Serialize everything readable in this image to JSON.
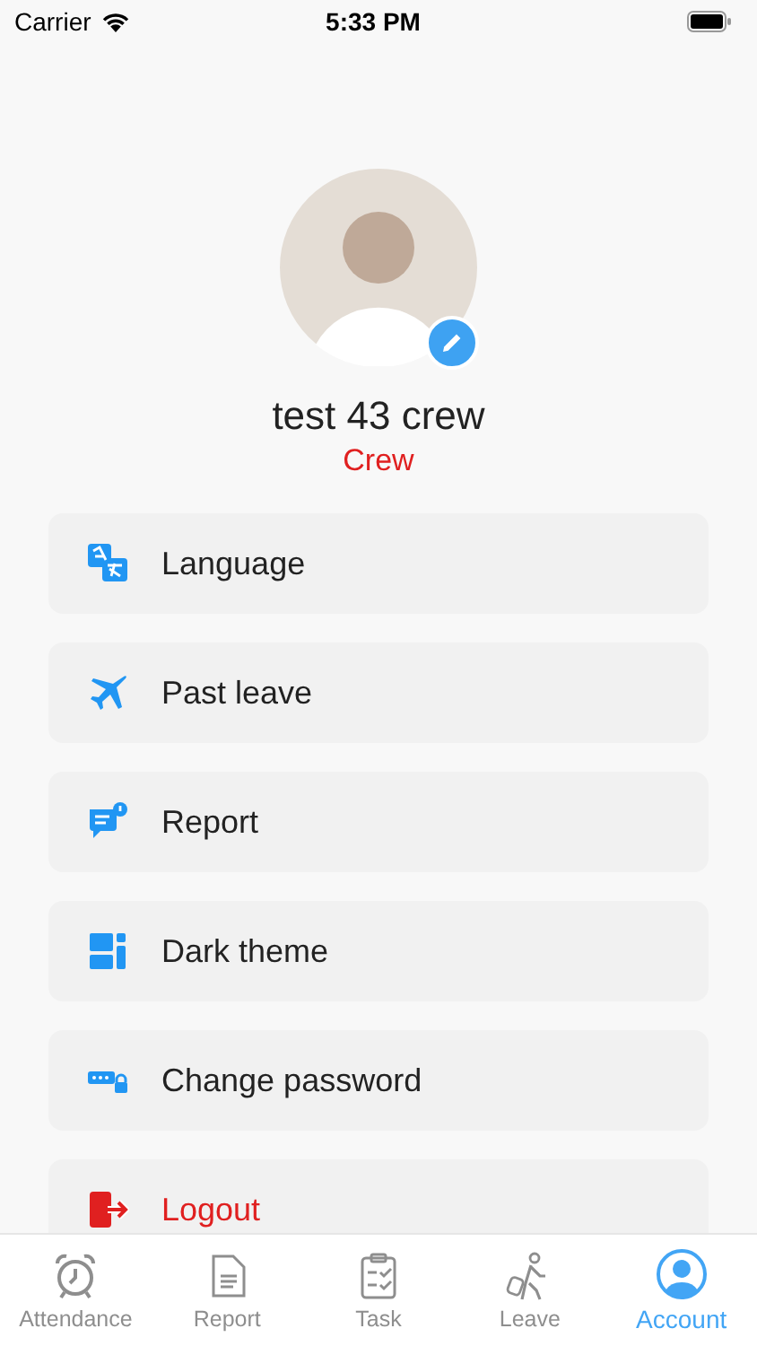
{
  "status_bar": {
    "carrier": "Carrier",
    "time": "5:33 PM"
  },
  "profile": {
    "name": "test 43 crew",
    "role": "Crew"
  },
  "menu": [
    {
      "label": "Language",
      "kind": "default"
    },
    {
      "label": "Past leave",
      "kind": "default"
    },
    {
      "label": "Report",
      "kind": "default"
    },
    {
      "label": "Dark theme",
      "kind": "default"
    },
    {
      "label": "Change password",
      "kind": "default"
    },
    {
      "label": "Logout",
      "kind": "danger"
    }
  ],
  "tabs": [
    {
      "label": "Attendance",
      "selected": false
    },
    {
      "label": "Report",
      "selected": false
    },
    {
      "label": "Task",
      "selected": false
    },
    {
      "label": "Leave",
      "selected": false
    },
    {
      "label": "Account",
      "selected": true
    }
  ]
}
